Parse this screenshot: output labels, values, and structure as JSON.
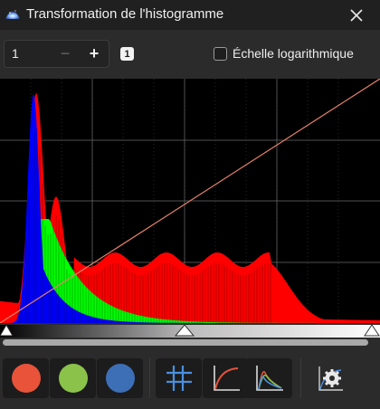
{
  "window": {
    "title": "Transformation de l'histogramme",
    "icon": "app-nebula-icon",
    "close_icon": "close-icon"
  },
  "toolbar": {
    "zoom_value": "1",
    "minus_label": "−",
    "plus_label": "+",
    "channel_badge": "1",
    "log_scale_label": "Échelle logarithmique",
    "log_scale_checked": false
  },
  "histogram": {
    "background": "#000000",
    "grid_color": "#6a6a6a",
    "transfer_curve_color": "#e8826a",
    "channel_colors": {
      "red": "#ff0000",
      "green": "#00ff00",
      "blue": "#0000ff"
    },
    "midtones_fraction": 0.5,
    "shadows_fraction": 0.0,
    "highlights_fraction": 1.0
  },
  "bottom_toolbar": {
    "channel_buttons": [
      {
        "name": "red-channel-button",
        "color": "#e8533a"
      },
      {
        "name": "green-channel-button",
        "color": "#8bc34a"
      },
      {
        "name": "blue-channel-button",
        "color": "#3d6fb6"
      }
    ],
    "tools": [
      {
        "name": "grid-toggle-button",
        "icon": "grid-icon"
      },
      {
        "name": "curve-toggle-button",
        "icon": "curve-icon"
      },
      {
        "name": "histogram-display-button",
        "icon": "histogram-icon"
      },
      {
        "name": "settings-button",
        "icon": "gear-icon"
      }
    ]
  }
}
